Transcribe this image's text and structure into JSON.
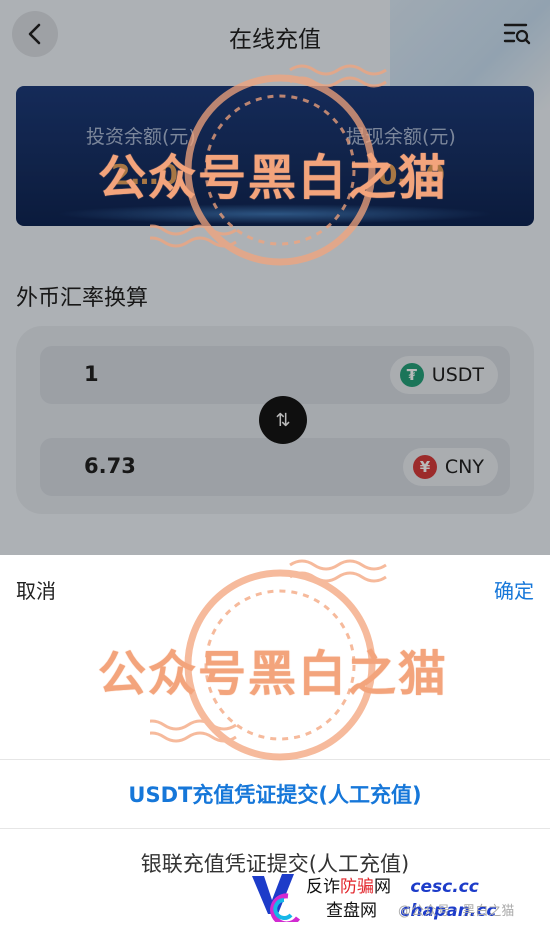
{
  "header": {
    "title": "在线充值"
  },
  "balance": {
    "invest_label": "投资余额(元)",
    "invest_value": "2…0",
    "withdraw_label": "提现余额(元)",
    "withdraw_value": "0…0"
  },
  "exchange": {
    "section_title": "外币汇率换算",
    "from": {
      "amount": "1",
      "currency": "USDT",
      "icon_glyph": "₮",
      "icon_color": "#26a17b"
    },
    "to": {
      "amount": "6.73",
      "currency": "CNY",
      "icon_glyph": "¥",
      "icon_color": "#d63b3b"
    },
    "swap_glyph": "⇅"
  },
  "sheet": {
    "cancel_label": "取消",
    "confirm_label": "确定",
    "options": [
      {
        "label": "USDT充值凭证提交(人工充值)",
        "selected": true
      },
      {
        "label": "银联充值凭证提交(人工充值)",
        "selected": false
      }
    ]
  },
  "watermark": {
    "stamp_text": "公众号黑白之猫",
    "brand_line1_a": "反诈",
    "brand_line1_b": "防骗",
    "brand_line1_c": "网",
    "brand_domain1": "cesc.cc",
    "brand_line2": "查盘网",
    "brand_domain2": "chapan.cc",
    "credit": "@公众号 · 黑白之猫"
  },
  "colors": {
    "accent": "#1677d9",
    "card_bg": "#1d3b7a",
    "stamp": "#f3a47c"
  }
}
